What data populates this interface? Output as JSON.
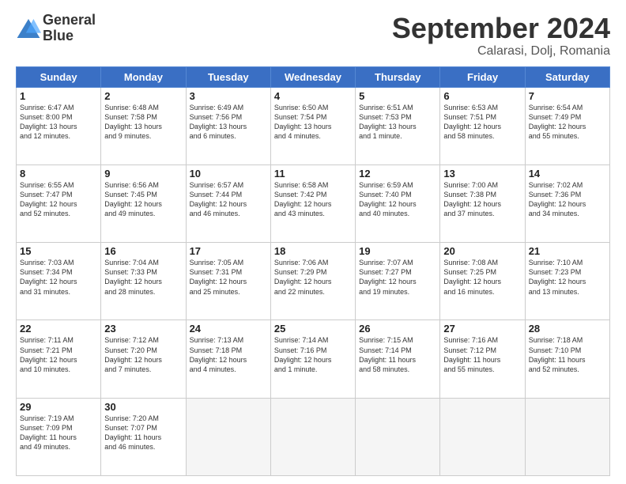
{
  "header": {
    "logo_line1": "General",
    "logo_line2": "Blue",
    "month_title": "September 2024",
    "location": "Calarasi, Dolj, Romania"
  },
  "weekdays": [
    "Sunday",
    "Monday",
    "Tuesday",
    "Wednesday",
    "Thursday",
    "Friday",
    "Saturday"
  ],
  "days": [
    {
      "num": "",
      "info": ""
    },
    {
      "num": "",
      "info": ""
    },
    {
      "num": "",
      "info": ""
    },
    {
      "num": "1",
      "info": "Sunrise: 6:47 AM\nSunset: 8:00 PM\nDaylight: 13 hours\nand 12 minutes."
    },
    {
      "num": "2",
      "info": "Sunrise: 6:48 AM\nSunset: 7:58 PM\nDaylight: 13 hours\nand 9 minutes."
    },
    {
      "num": "3",
      "info": "Sunrise: 6:49 AM\nSunset: 7:56 PM\nDaylight: 13 hours\nand 6 minutes."
    },
    {
      "num": "4",
      "info": "Sunrise: 6:50 AM\nSunset: 7:54 PM\nDaylight: 13 hours\nand 4 minutes."
    },
    {
      "num": "5",
      "info": "Sunrise: 6:51 AM\nSunset: 7:53 PM\nDaylight: 13 hours\nand 1 minute."
    },
    {
      "num": "6",
      "info": "Sunrise: 6:53 AM\nSunset: 7:51 PM\nDaylight: 12 hours\nand 58 minutes."
    },
    {
      "num": "7",
      "info": "Sunrise: 6:54 AM\nSunset: 7:49 PM\nDaylight: 12 hours\nand 55 minutes."
    },
    {
      "num": "8",
      "info": "Sunrise: 6:55 AM\nSunset: 7:47 PM\nDaylight: 12 hours\nand 52 minutes."
    },
    {
      "num": "9",
      "info": "Sunrise: 6:56 AM\nSunset: 7:45 PM\nDaylight: 12 hours\nand 49 minutes."
    },
    {
      "num": "10",
      "info": "Sunrise: 6:57 AM\nSunset: 7:44 PM\nDaylight: 12 hours\nand 46 minutes."
    },
    {
      "num": "11",
      "info": "Sunrise: 6:58 AM\nSunset: 7:42 PM\nDaylight: 12 hours\nand 43 minutes."
    },
    {
      "num": "12",
      "info": "Sunrise: 6:59 AM\nSunset: 7:40 PM\nDaylight: 12 hours\nand 40 minutes."
    },
    {
      "num": "13",
      "info": "Sunrise: 7:00 AM\nSunset: 7:38 PM\nDaylight: 12 hours\nand 37 minutes."
    },
    {
      "num": "14",
      "info": "Sunrise: 7:02 AM\nSunset: 7:36 PM\nDaylight: 12 hours\nand 34 minutes."
    },
    {
      "num": "15",
      "info": "Sunrise: 7:03 AM\nSunset: 7:34 PM\nDaylight: 12 hours\nand 31 minutes."
    },
    {
      "num": "16",
      "info": "Sunrise: 7:04 AM\nSunset: 7:33 PM\nDaylight: 12 hours\nand 28 minutes."
    },
    {
      "num": "17",
      "info": "Sunrise: 7:05 AM\nSunset: 7:31 PM\nDaylight: 12 hours\nand 25 minutes."
    },
    {
      "num": "18",
      "info": "Sunrise: 7:06 AM\nSunset: 7:29 PM\nDaylight: 12 hours\nand 22 minutes."
    },
    {
      "num": "19",
      "info": "Sunrise: 7:07 AM\nSunset: 7:27 PM\nDaylight: 12 hours\nand 19 minutes."
    },
    {
      "num": "20",
      "info": "Sunrise: 7:08 AM\nSunset: 7:25 PM\nDaylight: 12 hours\nand 16 minutes."
    },
    {
      "num": "21",
      "info": "Sunrise: 7:10 AM\nSunset: 7:23 PM\nDaylight: 12 hours\nand 13 minutes."
    },
    {
      "num": "22",
      "info": "Sunrise: 7:11 AM\nSunset: 7:21 PM\nDaylight: 12 hours\nand 10 minutes."
    },
    {
      "num": "23",
      "info": "Sunrise: 7:12 AM\nSunset: 7:20 PM\nDaylight: 12 hours\nand 7 minutes."
    },
    {
      "num": "24",
      "info": "Sunrise: 7:13 AM\nSunset: 7:18 PM\nDaylight: 12 hours\nand 4 minutes."
    },
    {
      "num": "25",
      "info": "Sunrise: 7:14 AM\nSunset: 7:16 PM\nDaylight: 12 hours\nand 1 minute."
    },
    {
      "num": "26",
      "info": "Sunrise: 7:15 AM\nSunset: 7:14 PM\nDaylight: 11 hours\nand 58 minutes."
    },
    {
      "num": "27",
      "info": "Sunrise: 7:16 AM\nSunset: 7:12 PM\nDaylight: 11 hours\nand 55 minutes."
    },
    {
      "num": "28",
      "info": "Sunrise: 7:18 AM\nSunset: 7:10 PM\nDaylight: 11 hours\nand 52 minutes."
    },
    {
      "num": "29",
      "info": "Sunrise: 7:19 AM\nSunset: 7:09 PM\nDaylight: 11 hours\nand 49 minutes."
    },
    {
      "num": "30",
      "info": "Sunrise: 7:20 AM\nSunset: 7:07 PM\nDaylight: 11 hours\nand 46 minutes."
    },
    {
      "num": "",
      "info": ""
    },
    {
      "num": "",
      "info": ""
    },
    {
      "num": "",
      "info": ""
    },
    {
      "num": "",
      "info": ""
    },
    {
      "num": "",
      "info": ""
    }
  ]
}
